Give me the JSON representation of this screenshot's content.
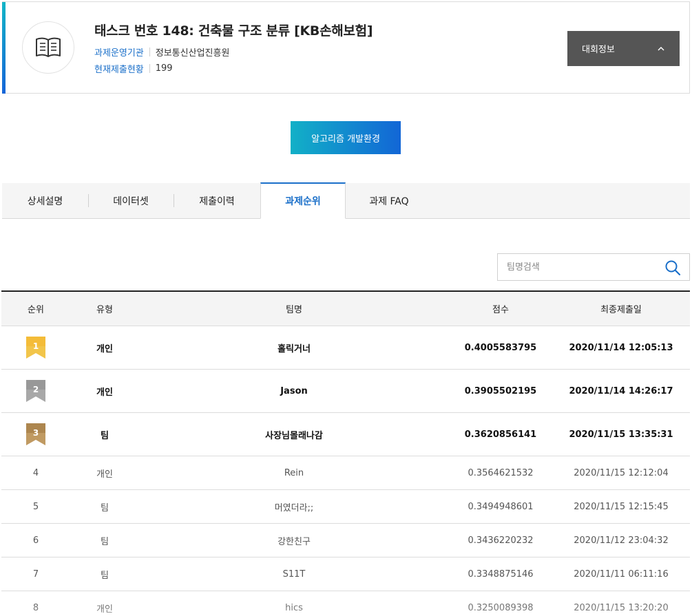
{
  "task": {
    "title": "태스크 번호 148: 건축물 구조 분류 [KB손해보험]",
    "meta": [
      {
        "key": "과제운영기관",
        "value": "정보통신산업진흥원"
      },
      {
        "key": "현재제출현황",
        "value": "199"
      }
    ],
    "info_button": "대회정보",
    "accent_colors": [
      "#12b5c7",
      "#1565d8"
    ]
  },
  "algo_button": "알고리즘 개발환경",
  "tabs": [
    {
      "label": "상세설명",
      "active": false
    },
    {
      "label": "데이터셋",
      "active": false
    },
    {
      "label": "제출이력",
      "active": false
    },
    {
      "label": "과제순위",
      "active": true
    },
    {
      "label": "과제 FAQ",
      "active": false
    }
  ],
  "search": {
    "placeholder": "팀명검색",
    "value": ""
  },
  "table": {
    "headers": [
      "순위",
      "유형",
      "팀명",
      "점수",
      "최종제출일"
    ],
    "rows": [
      {
        "rank": "1",
        "type": "개인",
        "team": "홀릭거너",
        "score": "0.4005583795",
        "date": "2020/11/14 12:05:13",
        "medal": "gold"
      },
      {
        "rank": "2",
        "type": "개인",
        "team": "Jason",
        "score": "0.3905502195",
        "date": "2020/11/14 14:26:17",
        "medal": "silver"
      },
      {
        "rank": "3",
        "type": "팀",
        "team": "사장님몰래나감",
        "score": "0.3620856141",
        "date": "2020/11/15 13:35:31",
        "medal": "bronze"
      },
      {
        "rank": "4",
        "type": "개인",
        "team": "Rein",
        "score": "0.3564621532",
        "date": "2020/11/15 12:12:04"
      },
      {
        "rank": "5",
        "type": "팀",
        "team": "머였더라;;",
        "score": "0.3494948601",
        "date": "2020/11/15 12:15:45"
      },
      {
        "rank": "6",
        "type": "팀",
        "team": "강한친구",
        "score": "0.3436220232",
        "date": "2020/11/12 23:04:32"
      },
      {
        "rank": "7",
        "type": "팀",
        "team": "S11T",
        "score": "0.3348875146",
        "date": "2020/11/11 06:11:16"
      },
      {
        "rank": "8",
        "type": "개인",
        "team": "hics",
        "score": "0.3250089398",
        "date": "2020/11/15 13:20:20"
      }
    ]
  },
  "colors": {
    "link_blue": "#1a6fc9",
    "gold": "#f2c54a",
    "silver": "#9e9e9e",
    "bronze": "#b58f5a"
  }
}
